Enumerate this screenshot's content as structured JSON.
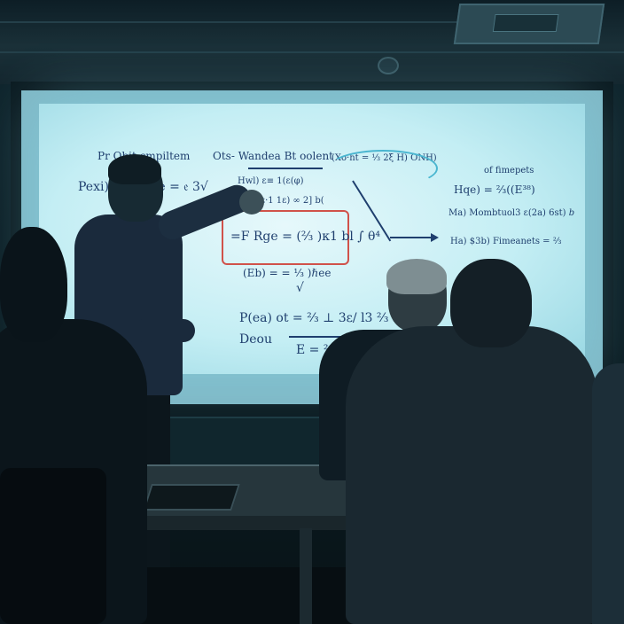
{
  "scene": {
    "description_free": true,
    "colors": {
      "screen_glow": "#c4eef4",
      "ink": "#1f3f6e",
      "highlight_box": "#d0524a",
      "accent_curve": "#4ab6d0",
      "room_dark": "#0a141b"
    },
    "whiteboard": {
      "top_left": "Pr Obit  cmpiltem",
      "top_center": "Ots- Wandea Bt oolent",
      "top_right": "(Xo·ht = ⅓ 2ξ H)  ONH)",
      "top_far_right": "of fimepets",
      "line_p": "Pexi) 𝔢 by) Ide = 𝔢 3√",
      "line_hw": "Hwl) ε≡ 1(ε(φ)",
      "line_hw2": "[ε·1 1ε) ∞ 2] b(",
      "boxed": "=F Rge = (⅔ )κ1 bl ∫ θ⁴",
      "line_hqe": "Hqe)  =  ⅔((E³⁸)",
      "line_ma": "Ma)  Mombtuol3 ε(2a) 6st) 𝑏",
      "line_ha": "Ha) $3b) Fimeanets = ⅔",
      "line_ebc": "(Eb) = = ⅓ )ℏee",
      "line_check": "√",
      "line_pea": "P(ea) ot = ⅔ ⊥ 3ε/ l3 ⅔ ε ol",
      "line_decu": "Deou",
      "line_e": "E = ⅔ ="
    }
  }
}
